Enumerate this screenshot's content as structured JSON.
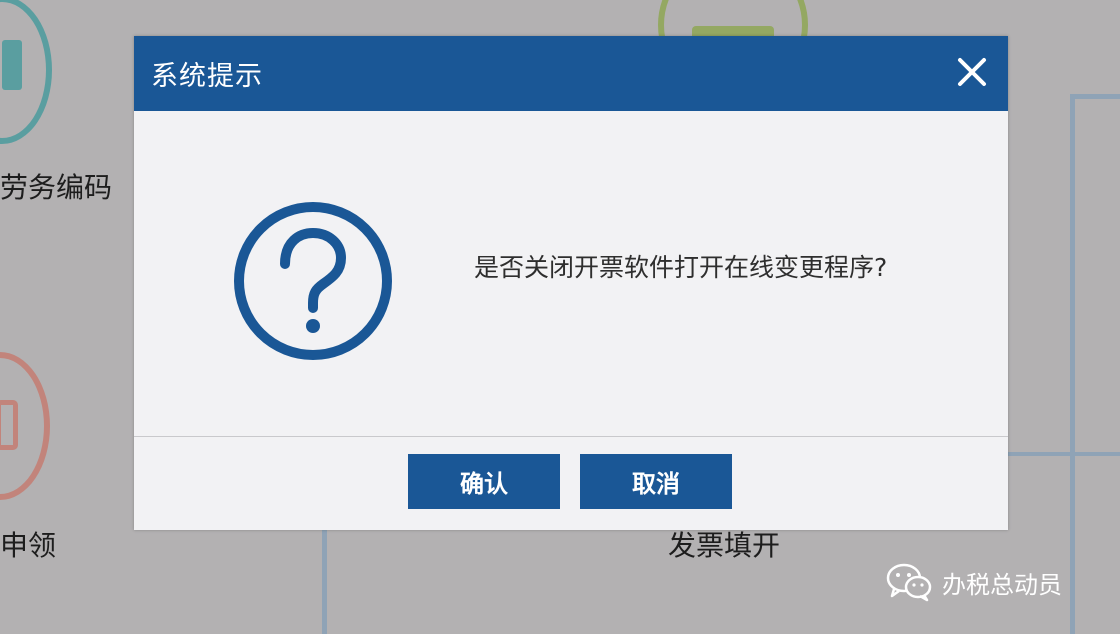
{
  "background": {
    "labels": {
      "service_code": "劳务编码",
      "apply": "申领",
      "invoice_fill": "发票填开"
    }
  },
  "dialog": {
    "title": "系统提示",
    "message": "是否关闭开票软件打开在线变更程序?",
    "confirm_label": "确认",
    "cancel_label": "取消",
    "icon": "question-circle-icon"
  },
  "watermark": {
    "text": "办税总动员",
    "icon": "wechat-icon"
  },
  "colors": {
    "header": "#1a5796",
    "button": "#1a5796",
    "overlay": "#b3b1b2",
    "dialog_body": "#f2f2f4"
  }
}
